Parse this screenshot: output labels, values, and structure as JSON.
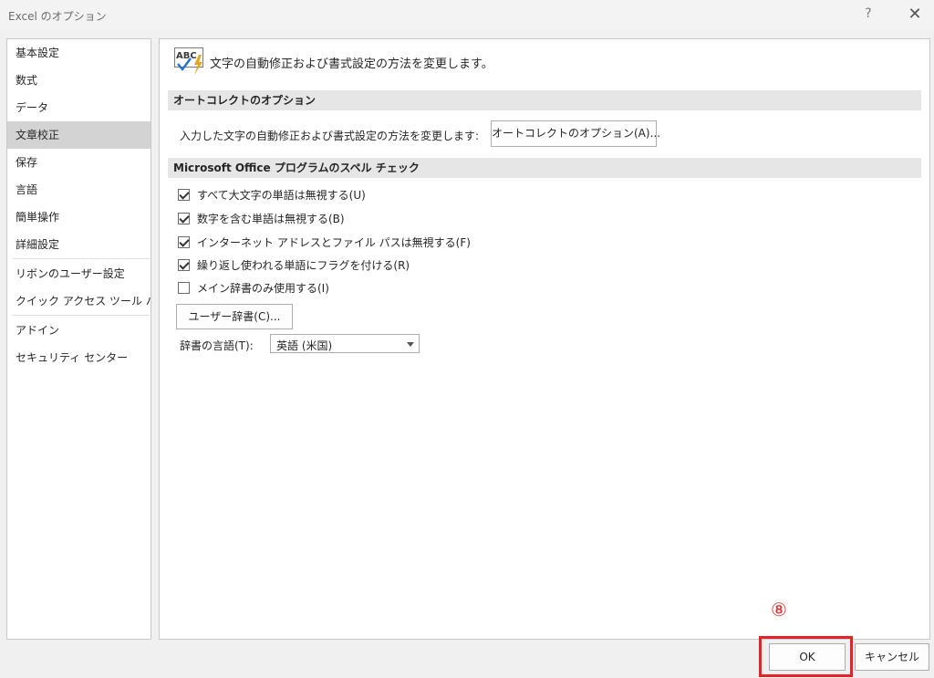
{
  "window": {
    "title": "Excel のオプション",
    "help_glyph": "?",
    "close_glyph": "✕"
  },
  "sidebar": {
    "items": [
      {
        "label": "基本設定"
      },
      {
        "label": "数式"
      },
      {
        "label": "データ"
      },
      {
        "label": "文章校正",
        "selected": true
      },
      {
        "label": "保存"
      },
      {
        "label": "言語"
      },
      {
        "label": "簡単操作"
      },
      {
        "label": "詳細設定"
      },
      {
        "label": "リボンのユーザー設定"
      },
      {
        "label": "クイック アクセス ツール バー"
      },
      {
        "label": "アドイン"
      },
      {
        "label": "セキュリティ センター"
      }
    ]
  },
  "main": {
    "heading": "文字の自動修正および書式設定の方法を変更します。",
    "icon": "abc-proofing-icon",
    "autocorrect": {
      "section_title": "オートコレクトのオプション",
      "description": "入力した文字の自動修正および書式設定の方法を変更します:",
      "button_label": "オートコレクトのオプション(A)..."
    },
    "spelling": {
      "section_title": "Microsoft Office プログラムのスペル チェック",
      "options": [
        {
          "label": "すべて大文字の単語は無視する(U)",
          "checked": true
        },
        {
          "label": "数字を含む単語は無視する(B)",
          "checked": true
        },
        {
          "label": "インターネット アドレスとファイル パスは無視する(F)",
          "checked": true
        },
        {
          "label": "繰り返し使われる単語にフラグを付ける(R)",
          "checked": true
        },
        {
          "label": "メイン辞書のみ使用する(I)",
          "checked": false
        }
      ],
      "custom_dict_button": "ユーザー辞書(C)...",
      "dict_language_label": "辞書の言語(T):",
      "dict_language_value": "英語 (米国)"
    }
  },
  "footer": {
    "ok_label": "OK",
    "cancel_label": "キャンセル",
    "step_marker": "⑧"
  },
  "colors": {
    "annotation": "#e52226",
    "selected_nav": "#d3d3d3",
    "section_band": "#e6e6e6"
  }
}
